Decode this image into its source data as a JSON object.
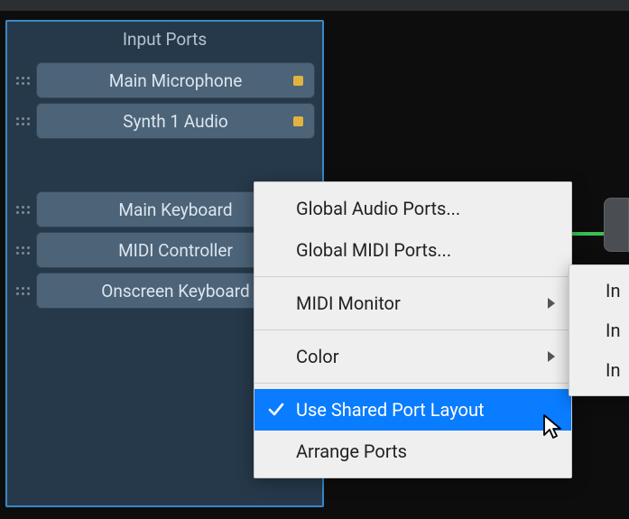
{
  "panel": {
    "title": "Input Ports",
    "audio_ports": [
      {
        "label": "Main Microphone",
        "dot_color": "#e3b341"
      },
      {
        "label": "Synth 1 Audio",
        "dot_color": "#e3b341"
      }
    ],
    "midi_ports": [
      {
        "label": "Main Keyboard"
      },
      {
        "label": "MIDI Controller"
      },
      {
        "label": "Onscreen Keyboard"
      }
    ]
  },
  "menu": {
    "global_audio": "Global Audio Ports...",
    "global_midi": "Global MIDI Ports...",
    "midi_monitor": "MIDI Monitor",
    "color": "Color",
    "use_shared": "Use Shared Port Layout",
    "arrange": "Arrange Ports"
  },
  "submenu": {
    "item1": "In",
    "item2": "In",
    "item3": "In"
  },
  "colors": {
    "highlight": "#0a7cff"
  }
}
